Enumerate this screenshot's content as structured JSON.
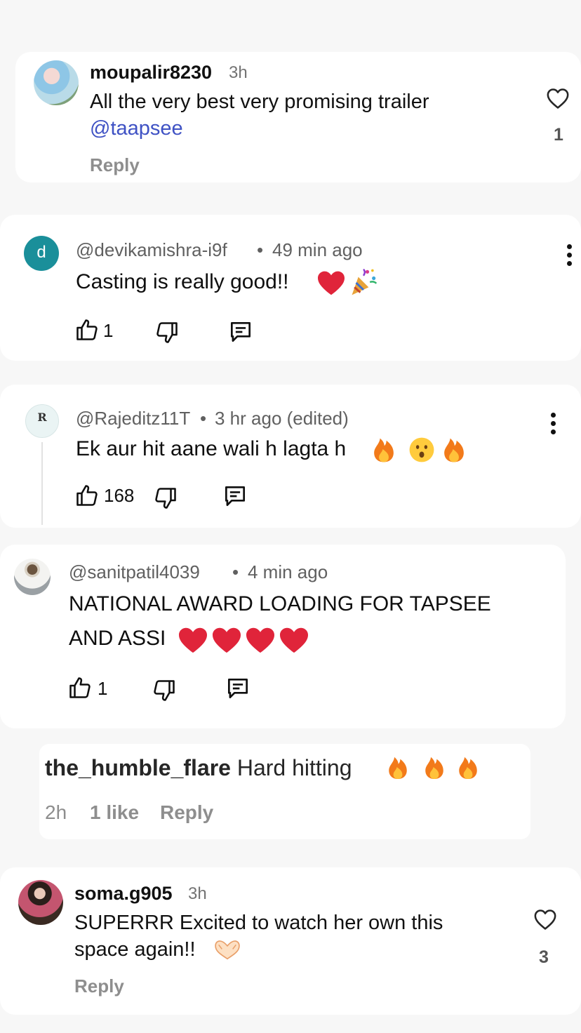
{
  "colors": {
    "page_bg": "#f7f7f7",
    "card_bg": "#ffffff",
    "mention": "#3f52c4",
    "yt_avatar_d": "#1a8f9a",
    "heart": "#e0243a",
    "fire": "#f27a1a"
  },
  "comment1": {
    "username": "moupalir8230",
    "time": "3h",
    "text_line1": "All the very best very promising trailer",
    "mention": "@taapsee",
    "reply_label": "Reply",
    "like_count": "1",
    "icon": "heart-outline-icon"
  },
  "comment2": {
    "avatar_letter": "d",
    "handle": "@devikamishra-i9f",
    "separator": "•",
    "time": "49 min ago",
    "text": "Casting is really good!!",
    "emojis": [
      "❤️",
      "🎉"
    ],
    "like_count": "1",
    "icons": [
      "thumbs-up-icon",
      "thumbs-down-icon",
      "reply-comment-icon",
      "more-vert-icon"
    ]
  },
  "comment3": {
    "avatar_text": "R",
    "handle": "@Rajeditz11T",
    "separator": "•",
    "time": "3 hr ago (edited)",
    "text": "Ek aur hit aane wali h lagta h",
    "emojis": [
      "🔥",
      "😮",
      "🔥"
    ],
    "like_count": "168",
    "icons": [
      "thumbs-up-icon",
      "thumbs-down-icon",
      "reply-comment-icon",
      "more-vert-icon"
    ]
  },
  "comment4": {
    "handle": "@sanitpatil4039",
    "separator": "•",
    "time": "4 min ago",
    "text_line1": "NATIONAL AWARD LOADING FOR TAPSEE",
    "text_line2": "AND ASSI",
    "emojis": [
      "❤️",
      "❤️",
      "❤️",
      "❤️"
    ],
    "like_count": "1",
    "icons": [
      "thumbs-up-icon",
      "thumbs-down-icon",
      "reply-comment-icon"
    ]
  },
  "comment5": {
    "username": "the_humble_flare",
    "text": "Hard hitting",
    "emojis": [
      "🔥",
      "🔥",
      "🔥"
    ],
    "time": "2h",
    "likes": "1 like",
    "reply_label": "Reply"
  },
  "comment6": {
    "username": "soma.g905",
    "time": "3h",
    "text_line1": "SUPERRR Excited to watch her own this",
    "text_line2": "space again!!",
    "emoji": "🫶",
    "reply_label": "Reply",
    "like_count": "3",
    "icon": "heart-outline-icon"
  }
}
